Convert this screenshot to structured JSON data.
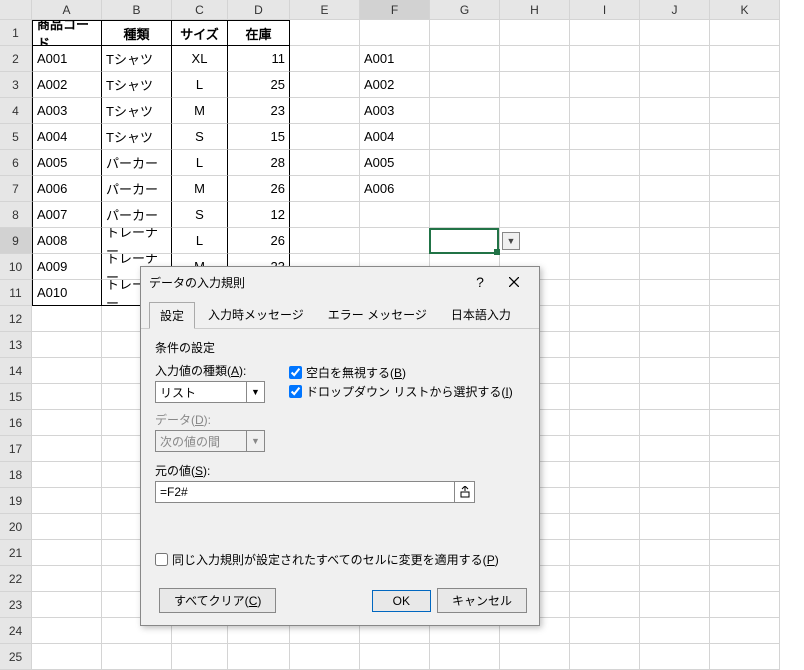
{
  "columns": [
    "A",
    "B",
    "C",
    "D",
    "E",
    "F",
    "G",
    "H",
    "I",
    "J",
    "K"
  ],
  "rows": 25,
  "selectedCell": {
    "row": 9,
    "col": "F"
  },
  "table": {
    "headers": {
      "code": "商品コード",
      "type": "種類",
      "size": "サイズ",
      "stock": "在庫"
    },
    "rows": [
      {
        "code": "A001",
        "type": "Tシャツ",
        "size": "XL",
        "stock": 11
      },
      {
        "code": "A002",
        "type": "Tシャツ",
        "size": "L",
        "stock": 25
      },
      {
        "code": "A003",
        "type": "Tシャツ",
        "size": "M",
        "stock": 23
      },
      {
        "code": "A004",
        "type": "Tシャツ",
        "size": "S",
        "stock": 15
      },
      {
        "code": "A005",
        "type": "パーカー",
        "size": "L",
        "stock": 28
      },
      {
        "code": "A006",
        "type": "パーカー",
        "size": "M",
        "stock": 26
      },
      {
        "code": "A007",
        "type": "パーカー",
        "size": "S",
        "stock": 12
      },
      {
        "code": "A008",
        "type": "トレーナー",
        "size": "L",
        "stock": 26
      },
      {
        "code": "A009",
        "type": "トレーナー",
        "size": "M",
        "stock": 23
      },
      {
        "code": "A010",
        "type": "トレーナー",
        "size": "",
        "stock": ""
      }
    ]
  },
  "colF": [
    "A001",
    "A002",
    "A003",
    "A004",
    "A005",
    "A006"
  ],
  "dialog": {
    "title": "データの入力規則",
    "tabs": [
      "設定",
      "入力時メッセージ",
      "エラー メッセージ",
      "日本語入力"
    ],
    "sectionTitle": "条件の設定",
    "allowLabel": "入力値の種類(A):",
    "allowValue": "リスト",
    "dataLabel": "データ(D):",
    "dataValue": "次の値の間",
    "ignoreBlank": "空白を無視する(B)",
    "inCellDropdown": "ドロップダウン リストから選択する(I)",
    "sourceLabel": "元の値(S):",
    "sourceValue": "=F2#",
    "applyAll": "同じ入力規則が設定されたすべてのセルに変更を適用する(P)",
    "clearAll": "すべてクリア(C)",
    "ok": "OK",
    "cancel": "キャンセル"
  }
}
